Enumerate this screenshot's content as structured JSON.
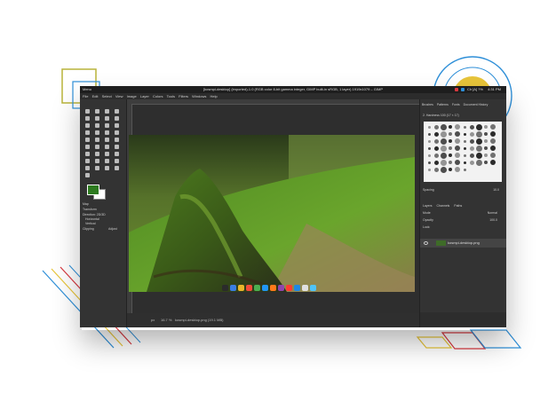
{
  "app": {
    "menu_label": "Menu",
    "window_title": "[kosmpi-desktop] (imported)-1.0 (RGB color 8-bit gamma integer, GIMP built-in sRGB, 1 layer) 1919x1079 – GIMP",
    "clock": "4:31 PM",
    "tray_text": "Ch [A] ?%"
  },
  "menubar": [
    "File",
    "Edit",
    "Select",
    "View",
    "Image",
    "Layer",
    "Colors",
    "Tools",
    "Filters",
    "Windows",
    "Help"
  ],
  "toolbox": {
    "tool_names": [
      "move",
      "align",
      "rect-select",
      "ellipse-select",
      "free-select",
      "fuzzy-select",
      "by-color-select",
      "scissors",
      "foreground-select",
      "crop",
      "unified-transform",
      "rotate",
      "scale",
      "shear",
      "flip",
      "perspective",
      "cage",
      "warp",
      "text",
      "bucket-fill",
      "gradient",
      "paintbrush",
      "pencil",
      "airbrush",
      "eraser",
      "ink",
      "mypaint",
      "clone",
      "heal",
      "perspective-clone",
      "blur",
      "smudge",
      "dodge",
      "paths",
      "color-picker",
      "measure",
      "zoom"
    ],
    "options_title": "Map",
    "transform_label": "Transform",
    "direction_label": "Direction: 2D/3D",
    "h_label": "Horizontal",
    "v_label": "Vertical",
    "clipping_label": "Clipping",
    "clipping_value": "Adjust"
  },
  "panel": {
    "tabs": [
      "Brushes",
      "Patterns",
      "Fonts",
      "Document History"
    ],
    "brush_set": "2. Hardness 100 (17 × 17)",
    "spacing_label": "Spacing",
    "spacing_value": "10.0",
    "layer_tabs": [
      "Layers",
      "Channels",
      "Paths"
    ],
    "mode_label": "Mode",
    "mode_value": "Normal",
    "opacity_label": "Opacity",
    "opacity_value": "100.0",
    "lock_label": "Lock:",
    "layer_name": "kosmpi-desktop.png"
  },
  "status": {
    "units": "px",
    "zoom": "16.7 %",
    "file": "kosmpi-desktop.png (19.1 MB)"
  },
  "colors": {
    "accent_green": "#2d7a1f",
    "deco_yellow": "#e8c53a",
    "deco_blue": "#2e8fd8",
    "deco_red": "#d7383f",
    "deco_olive": "#b9b43a"
  },
  "taskbar_icon_colors": [
    "#2b2b2b",
    "#3a7de0",
    "#e8b52a",
    "#f04a3a",
    "#4caf50",
    "#2196f3",
    "#ff7a1a",
    "#8e44ad",
    "#ff3b30",
    "#1e88e5",
    "#e0e0e0",
    "#4fc3f7"
  ]
}
